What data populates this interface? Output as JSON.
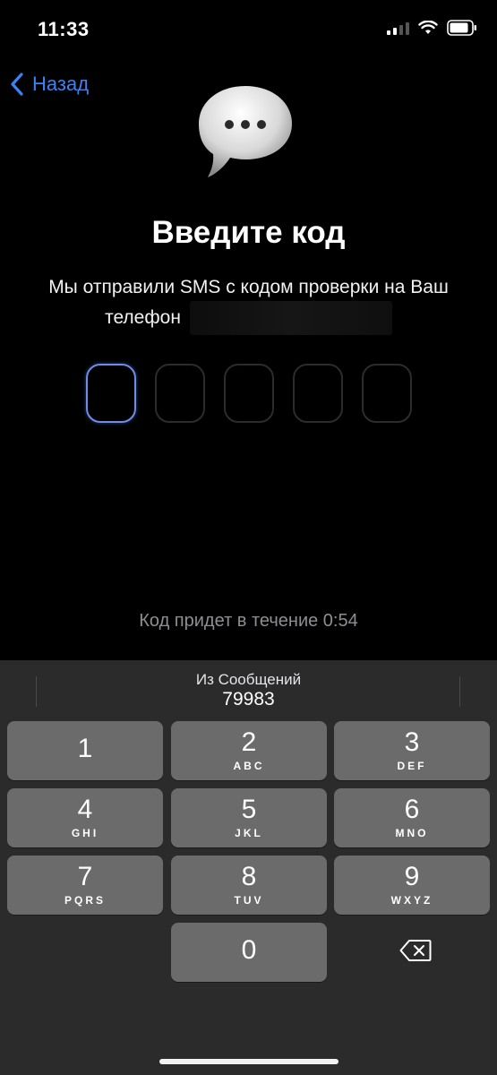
{
  "status_bar": {
    "time": "11:33"
  },
  "nav": {
    "back_label": "Назад"
  },
  "header": {
    "title": "Введите код",
    "subtitle_line1": "Мы отправили SMS с кодом проверки на Ваш",
    "subtitle_line2": "телефон"
  },
  "code_input": {
    "length": 5,
    "active_index": 0,
    "values": [
      "",
      "",
      "",
      "",
      ""
    ]
  },
  "timer_text": "Код придет в течение 0:54",
  "keyboard": {
    "suggestion_label": "Из Сообщений",
    "suggestion_code": "79983",
    "keys": [
      {
        "digit": "1",
        "letters": ""
      },
      {
        "digit": "2",
        "letters": "ABC"
      },
      {
        "digit": "3",
        "letters": "DEF"
      },
      {
        "digit": "4",
        "letters": "GHI"
      },
      {
        "digit": "5",
        "letters": "JKL"
      },
      {
        "digit": "6",
        "letters": "MNO"
      },
      {
        "digit": "7",
        "letters": "PQRS"
      },
      {
        "digit": "8",
        "letters": "TUV"
      },
      {
        "digit": "9",
        "letters": "WXYZ"
      },
      {
        "digit": "0",
        "letters": ""
      }
    ]
  },
  "icons": {
    "back": "chevron-left-icon",
    "bubble": "message-bubble-icon",
    "backspace": "backspace-icon"
  },
  "colors": {
    "accent": "#3b82f6",
    "active_box": "#6f8de8",
    "key_bg": "#6b6b6b",
    "keyboard_bg": "#2b2b2b"
  }
}
